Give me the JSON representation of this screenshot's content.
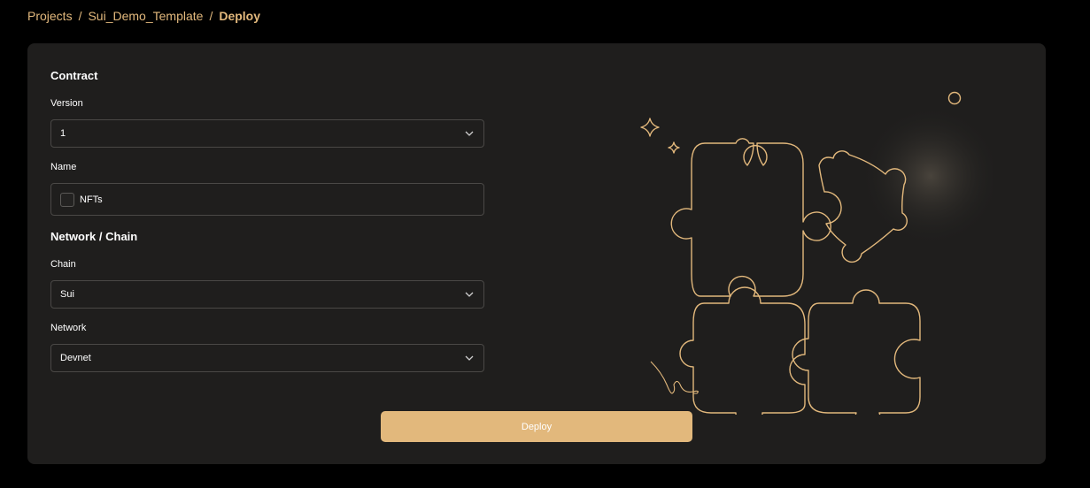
{
  "breadcrumb": {
    "items": [
      "Projects",
      "Sui_Demo_Template"
    ],
    "separator": "/",
    "current": "Deploy"
  },
  "contract": {
    "section_title": "Contract",
    "version_label": "Version",
    "version_value": "1",
    "name_label": "Name",
    "name_value": "NFTs"
  },
  "network": {
    "section_title": "Network / Chain",
    "chain_label": "Chain",
    "chain_value": "Sui",
    "network_label": "Network",
    "network_value": "Devnet"
  },
  "actions": {
    "deploy_label": "Deploy"
  },
  "colors": {
    "accent": "#e2b87c",
    "background": "#000000",
    "card": "#1f1e1d",
    "border": "#4a4846"
  }
}
